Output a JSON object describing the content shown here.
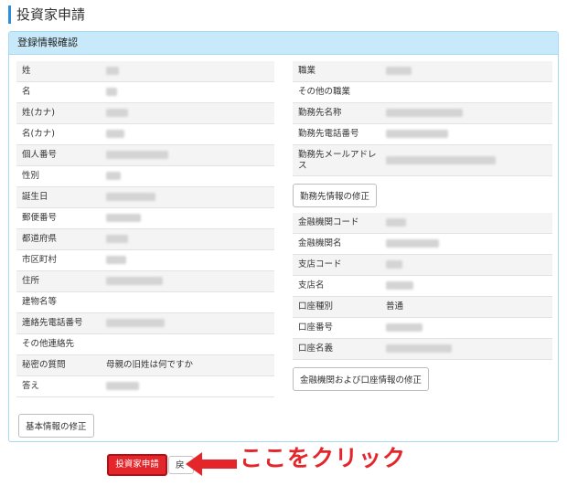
{
  "page_title": "投資家申請",
  "panel_title": "登録情報確認",
  "left_rows": [
    {
      "label": "姓",
      "value": "",
      "mask": 14
    },
    {
      "label": "名",
      "value": "",
      "mask": 12
    },
    {
      "label": "姓(カナ)",
      "value": "",
      "mask": 24
    },
    {
      "label": "名(カナ)",
      "value": "",
      "mask": 20
    },
    {
      "label": "個人番号",
      "value": "",
      "mask": 68
    },
    {
      "label": "性別",
      "value": "",
      "mask": 16
    },
    {
      "label": "誕生日",
      "value": "",
      "mask": 54
    },
    {
      "label": "郵便番号",
      "value": "",
      "mask": 38
    },
    {
      "label": "都道府県",
      "value": "",
      "mask": 24
    },
    {
      "label": "市区町村",
      "value": "",
      "mask": 22
    },
    {
      "label": "住所",
      "value": "",
      "mask": 62
    },
    {
      "label": "建物名等",
      "value": "",
      "mask": 0
    },
    {
      "label": "連絡先電話番号",
      "value": "",
      "mask": 64
    },
    {
      "label": "その他連絡先",
      "value": "",
      "mask": 0
    },
    {
      "label": "秘密の質問",
      "value": "母親の旧姓は何ですか",
      "mask": 0
    },
    {
      "label": "答え",
      "value": "",
      "mask": 36
    }
  ],
  "left_button": "基本情報の修正",
  "right_top_rows": [
    {
      "label": "職業",
      "value": "",
      "mask": 28
    },
    {
      "label": "その他の職業",
      "value": "",
      "mask": 0
    },
    {
      "label": "勤務先名称",
      "value": "",
      "mask": 84
    },
    {
      "label": "勤務先電話番号",
      "value": "",
      "mask": 68
    },
    {
      "label": "勤務先メールアドレス",
      "value": "",
      "mask": 120
    }
  ],
  "employer_button": "勤務先情報の修正",
  "right_bottom_rows": [
    {
      "label": "金融機関コード",
      "value": "",
      "mask": 22
    },
    {
      "label": "金融機関名",
      "value": "",
      "mask": 58
    },
    {
      "label": "支店コード",
      "value": "",
      "mask": 18
    },
    {
      "label": "支店名",
      "value": "",
      "mask": 30
    },
    {
      "label": "口座種別",
      "value": "普通",
      "mask": 0
    },
    {
      "label": "口座番号",
      "value": "",
      "mask": 40
    },
    {
      "label": "口座名義",
      "value": "",
      "mask": 72
    }
  ],
  "bank_button": "金融機関および口座情報の修正",
  "submit_button": "投資家申請",
  "back_button": "戻",
  "callout_text": "ここをクリック",
  "colors": {
    "accent_red": "#e4262b",
    "panel_header": "#c8e9fa",
    "title_bar": "#2f8fd8"
  }
}
